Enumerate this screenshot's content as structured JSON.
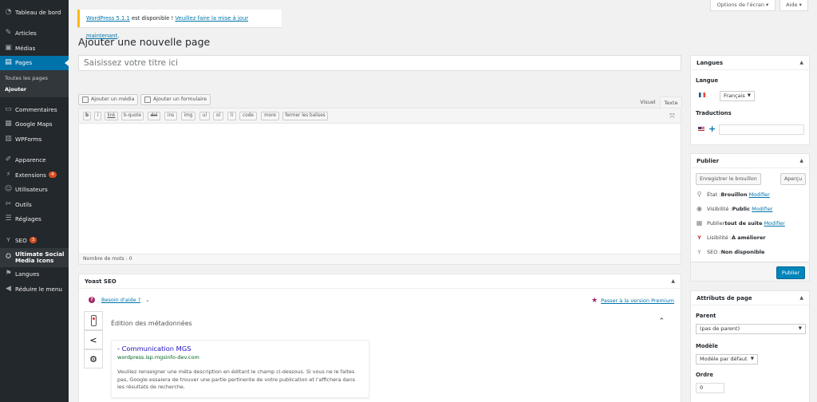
{
  "sidebar": {
    "items": [
      {
        "label": "Tableau de bord",
        "icon": "dashboard-icon"
      },
      {
        "label": "Articles",
        "icon": "pin-icon"
      },
      {
        "label": "Médias",
        "icon": "media-icon"
      },
      {
        "label": "Pages",
        "icon": "pages-icon"
      },
      {
        "label": "Commentaires",
        "icon": "comments-icon"
      },
      {
        "label": "Google Maps",
        "icon": "map-icon"
      },
      {
        "label": "WPForms",
        "icon": "forms-icon"
      },
      {
        "label": "Apparence",
        "icon": "brush-icon"
      },
      {
        "label": "Extensions",
        "icon": "plugin-icon",
        "badge": "4"
      },
      {
        "label": "Utilisateurs",
        "icon": "users-icon"
      },
      {
        "label": "Outils",
        "icon": "tools-icon"
      },
      {
        "label": "Réglages",
        "icon": "settings-icon"
      },
      {
        "label": "SEO",
        "icon": "yoast-icon",
        "badge": "3"
      },
      {
        "label": "Ultimate Social Media Icons",
        "icon": "social-icon"
      },
      {
        "label": "Langues",
        "icon": "languages-icon"
      },
      {
        "label": "Réduire le menu",
        "icon": "collapse-icon"
      }
    ],
    "submenu": [
      "Toutes les pages",
      "Ajouter"
    ]
  },
  "top": {
    "screen_options": "Options de l'écran",
    "help": "Aide"
  },
  "notice": {
    "link1": "WordPress 5.1.1",
    "text": " est disponible ! ",
    "link2": "Veuillez faire la mise à jour maintenant",
    "end": "."
  },
  "page_title": "Ajouter une nouvelle page",
  "title_placeholder": "Saisissez votre titre ici",
  "editor": {
    "add_media": "Ajouter un média",
    "add_form": "Ajouter un formulaire",
    "tab_visual": "Visuel",
    "tab_text": "Texte",
    "quicktags": [
      "b",
      "i",
      "link",
      "b-quote",
      "del",
      "ins",
      "img",
      "ul",
      "ol",
      "li",
      "code",
      "more",
      "fermer les balises"
    ],
    "word_count": "Nombre de mots : 0"
  },
  "yoast": {
    "title": "Yoast SEO",
    "help": "Besoin d'aide ?",
    "premium": "Passer à la version Premium",
    "meta_title": "Édition des métadonnées",
    "snippet_title": "- Communication MGS",
    "snippet_url": "wordpress.isp.mgsinfo-dev.com",
    "snippet_desc": "Veuillez renseigner une méta description en éditant le champ ci-dessous. Si vous ne le faites pas, Google essaiera de trouver une partie pertinente de votre publication et l'affichera dans les résultats de recherche."
  },
  "languages_box": {
    "title": "Langues",
    "lang_label": "Langue",
    "lang_value": "Français",
    "trans_label": "Traductions"
  },
  "publish_box": {
    "title": "Publier",
    "save_draft": "Enregistrer le brouillon",
    "preview": "Aperçu",
    "status_label": "État : ",
    "status_value": "Brouillon",
    "visibility_label": "Visibilité : ",
    "visibility_value": "Public",
    "schedule_text": "Publier ",
    "schedule_value": "tout de suite",
    "modify": "Modifier",
    "readability_label": "Lisibilité : ",
    "readability_value": "À améliorer",
    "seo_label": "SEO : ",
    "seo_value": "Non disponible",
    "publish": "Publier"
  },
  "attributes_box": {
    "title": "Attributs de page",
    "parent_label": "Parent",
    "parent_value": "(pas de parent)",
    "template_label": "Modèle",
    "template_value": "Modèle par défaut",
    "order_label": "Ordre",
    "order_value": "0"
  },
  "colors": {
    "accent": "#0073aa",
    "sidebar": "#23282d",
    "notice": "#ffb900",
    "yoast": "#a4286a"
  }
}
